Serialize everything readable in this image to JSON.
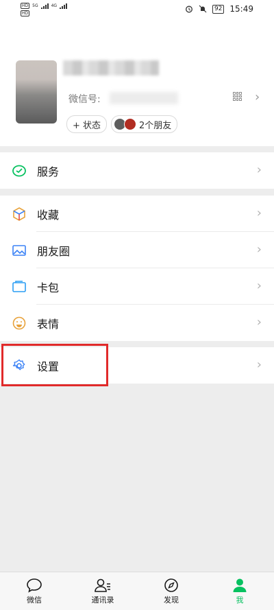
{
  "status_bar": {
    "sim1": "HD",
    "sim1_network": "5G",
    "sim2": "HD",
    "sim2_network": "4G",
    "battery": "92",
    "time": "15:49"
  },
  "profile": {
    "wechat_id_label": "微信号:",
    "status_button": "+ 状态",
    "friends_count": "2个朋友"
  },
  "menu": {
    "services": "服务",
    "favorites": "收藏",
    "moments": "朋友圈",
    "cards": "卡包",
    "stickers": "表情",
    "settings": "设置"
  },
  "tabs": [
    {
      "label": "微信",
      "icon": "chat-bubble-icon"
    },
    {
      "label": "通讯录",
      "icon": "contacts-icon"
    },
    {
      "label": "发现",
      "icon": "compass-icon"
    },
    {
      "label": "我",
      "icon": "person-icon",
      "active": true
    }
  ],
  "colors": {
    "accent": "#07c160",
    "highlight": "#e12a2a",
    "background": "#ededed"
  }
}
